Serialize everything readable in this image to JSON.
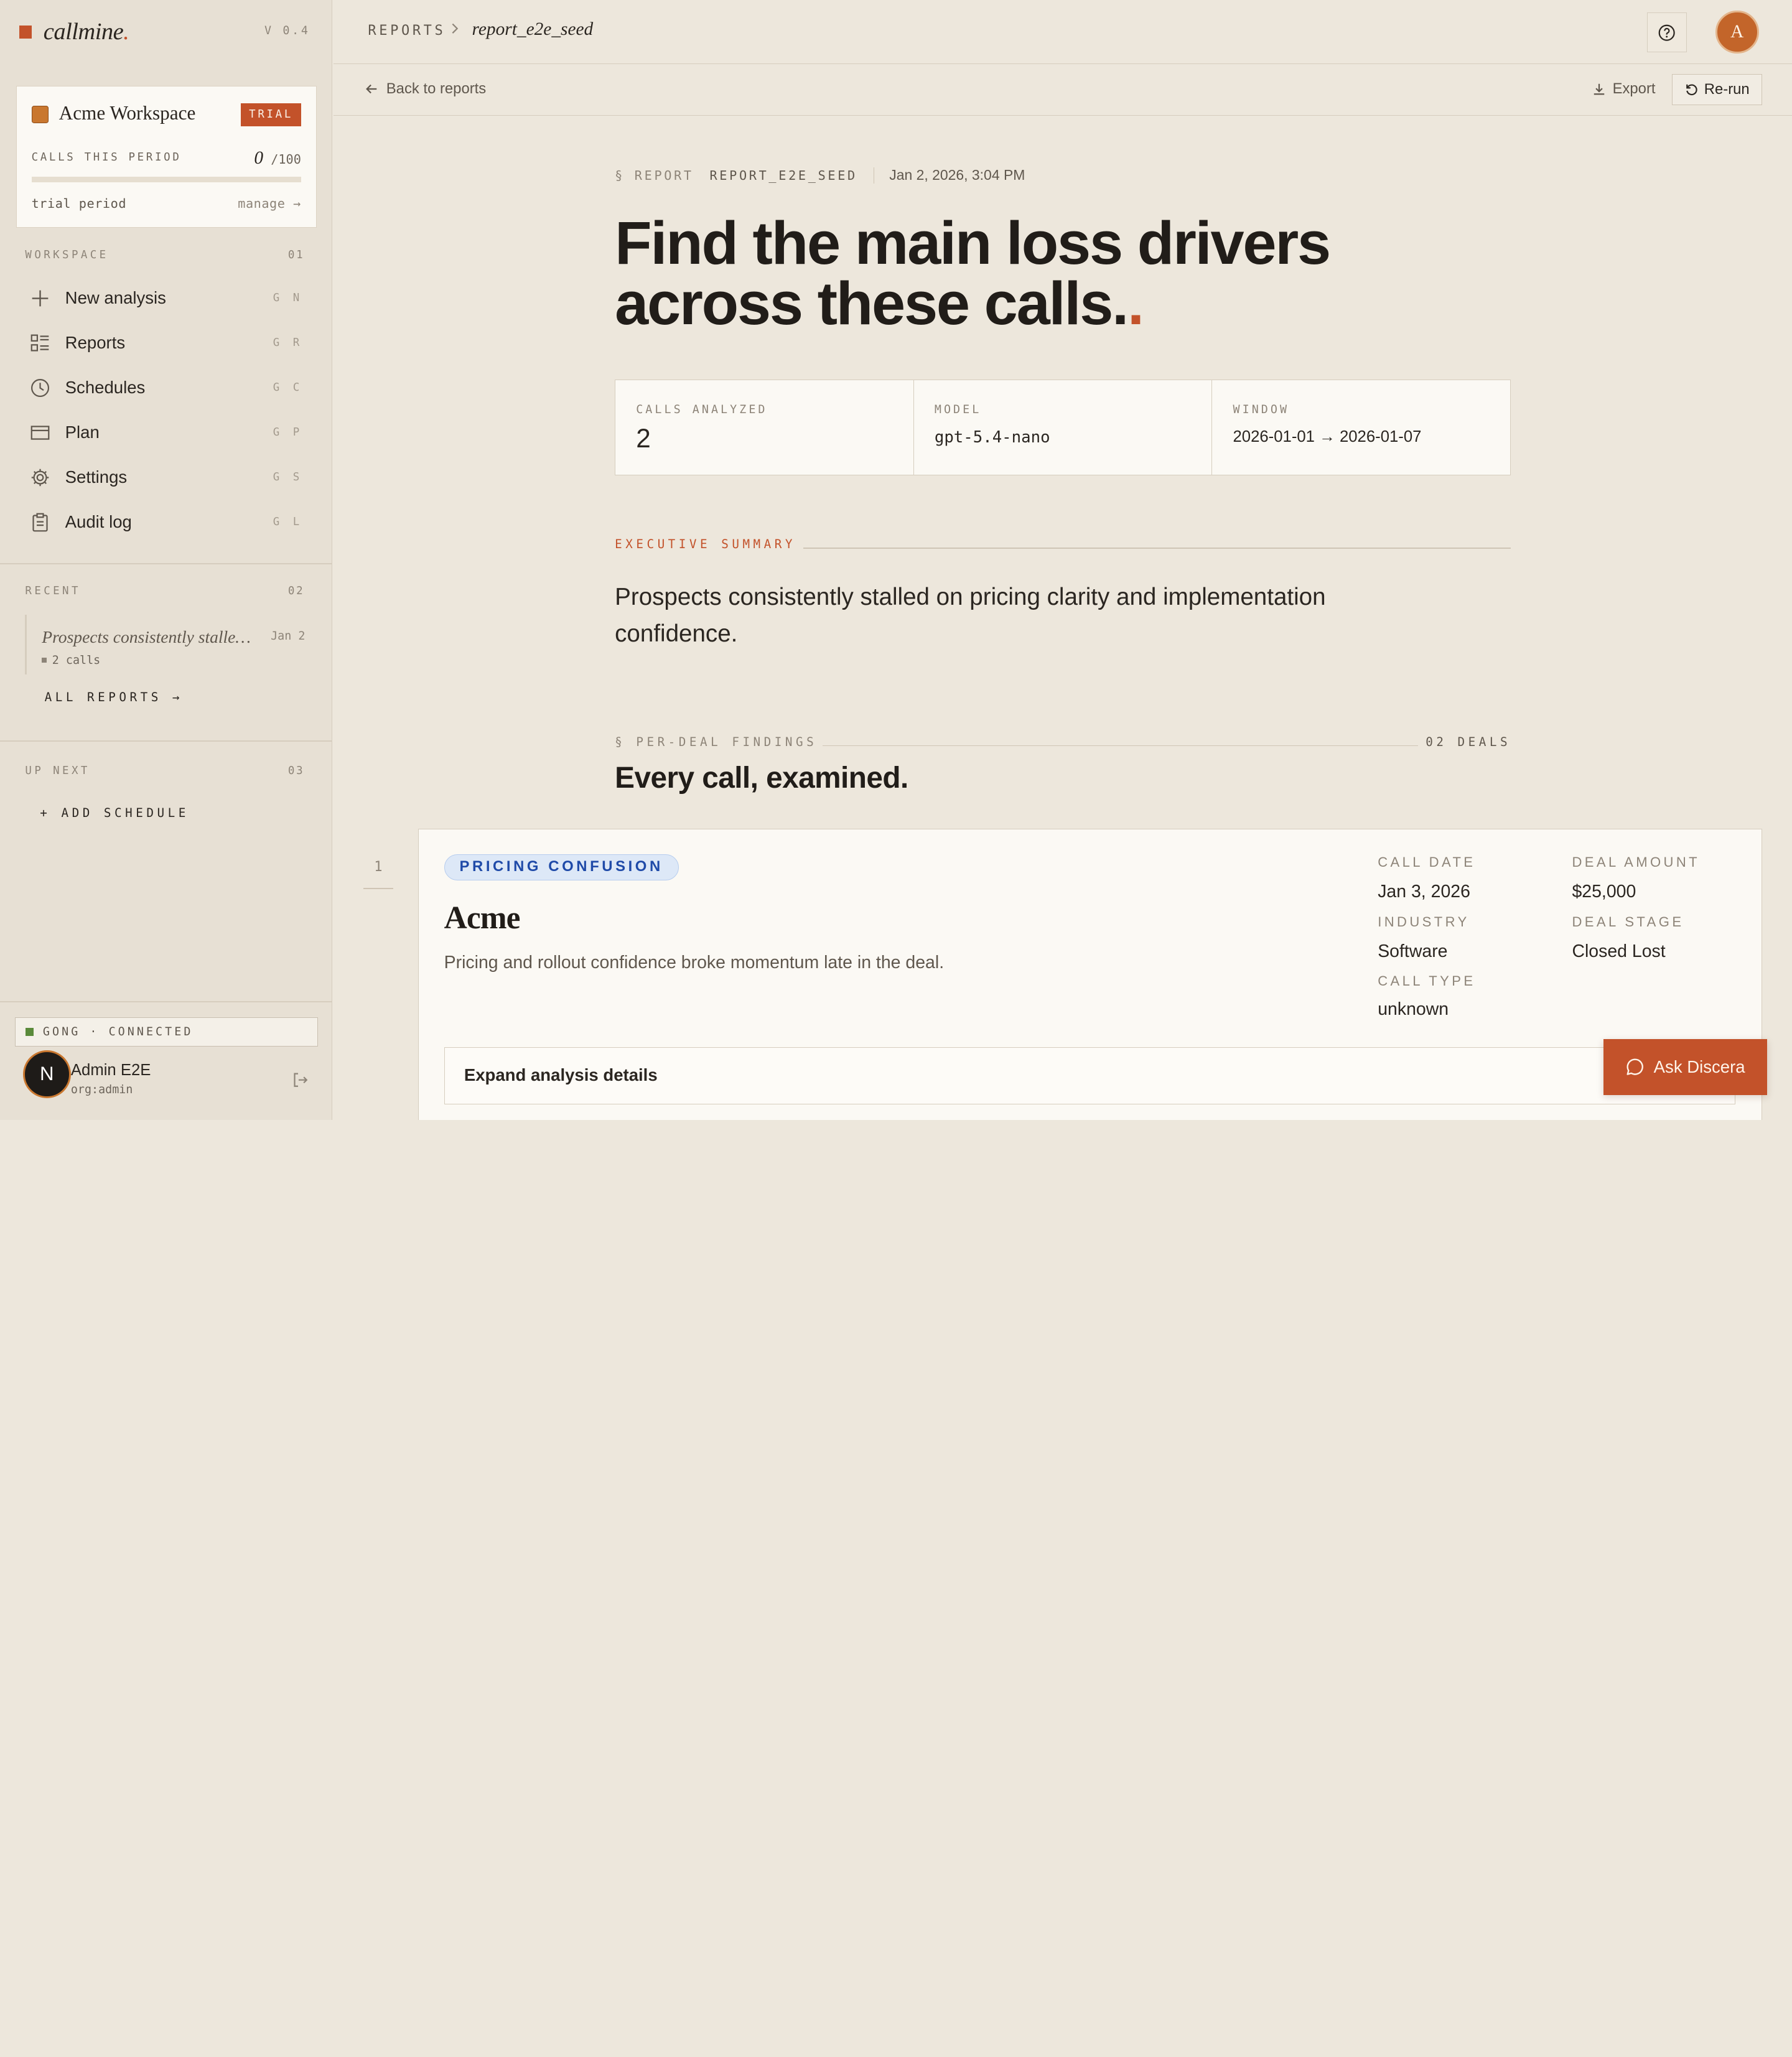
{
  "brand": {
    "name": "callmine",
    "dot": ".",
    "version": "V 0.4"
  },
  "workspace": {
    "name": "Acme Workspace",
    "badge": "TRIAL",
    "calls_label": "CALLS THIS PERIOD",
    "calls_used": "0",
    "calls_limit": "/100",
    "usage_fraction": 0,
    "trial_text": "trial period",
    "manage": "manage →"
  },
  "sidebar": {
    "workspace_label": "WORKSPACE",
    "workspace_count": "01",
    "items": [
      {
        "label": "New analysis",
        "key": "G N",
        "icon": "plus-icon"
      },
      {
        "label": "Reports",
        "key": "G R",
        "icon": "list-icon"
      },
      {
        "label": "Schedules",
        "key": "G C",
        "icon": "clock-icon"
      },
      {
        "label": "Plan",
        "key": "G P",
        "icon": "card-icon"
      },
      {
        "label": "Settings",
        "key": "G S",
        "icon": "gear-icon"
      },
      {
        "label": "Audit log",
        "key": "G L",
        "icon": "clipboard-icon"
      }
    ],
    "recent_label": "RECENT",
    "recent_count": "02",
    "recent": {
      "title": "Prospects consistently stalled on pricing clarity and implementation confidence.",
      "date": "Jan 2",
      "calls": "2 calls"
    },
    "all_reports": "ALL REPORTS →",
    "upnext_label": "UP NEXT",
    "upnext_count": "03",
    "add_schedule": "+ ADD SCHEDULE",
    "integration": "GONG · CONNECTED",
    "user": {
      "initial": "N",
      "name": "Admin E2E",
      "org": "org:admin"
    }
  },
  "topbar": {
    "crumb_root": "REPORTS",
    "crumb_current": "report_e2e_seed",
    "avatar_initial": "A"
  },
  "subbar": {
    "back": "Back to reports",
    "export": "Export",
    "rerun": "Re-run"
  },
  "report": {
    "meta_prefix": "§ REPORT",
    "meta_id": "REPORT_E2E_SEED",
    "meta_date": "Jan 2, 2026, 3:04 PM",
    "headline": "Find the main loss drivers across these calls.",
    "headline_dot": ".",
    "stats": [
      {
        "label": "CALLS ANALYZED",
        "value": "2"
      },
      {
        "label": "MODEL",
        "value": "gpt-5.4-nano"
      },
      {
        "label": "WINDOW",
        "value": "2026-01-01 → 2026-01-07"
      }
    ],
    "exec_label": "EXECUTIVE SUMMARY",
    "exec_text": "Prospects consistently stalled on pricing clarity and implementation confidence.",
    "perdeal_label": "§ PER-DEAL FINDINGS",
    "perdeal_count": "02 DEALS",
    "perdeal_title": "Every call, examined."
  },
  "deal": {
    "number": "1",
    "tag": "PRICING CONFUSION",
    "name": "Acme",
    "summary": "Pricing and rollout confidence broke momentum late in the deal.",
    "call_date_label": "CALL DATE",
    "call_date": "Jan 3, 2026",
    "deal_amount_label": "DEAL AMOUNT",
    "deal_amount": "$25,000",
    "industry_label": "INDUSTRY",
    "industry": "Software",
    "deal_stage_label": "DEAL STAGE",
    "deal_stage": "Closed Lost",
    "call_type_label": "CALL TYPE",
    "call_type": "unknown",
    "expand": "Expand analysis details"
  },
  "assistant": {
    "label": "Ask Discera"
  },
  "colors": {
    "accent": "#c3522a",
    "background": "#ede7dc",
    "tag_blue": "#1f4aa8",
    "connected": "#5a8a3a"
  }
}
